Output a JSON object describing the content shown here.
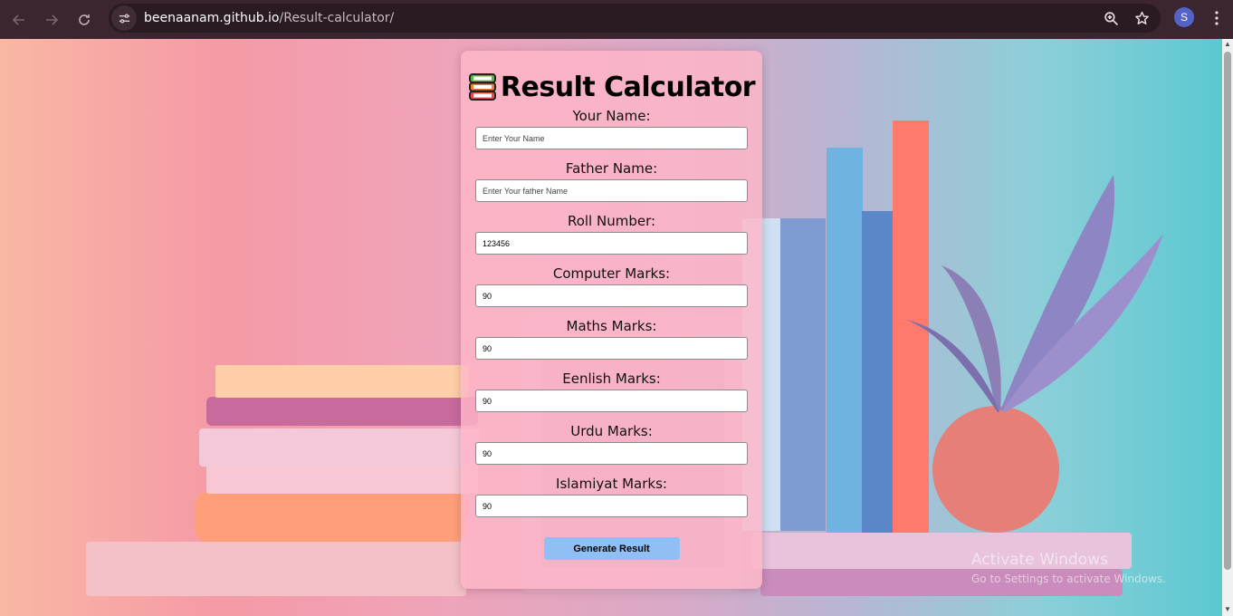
{
  "browser": {
    "url_host": "beenaanam.github.io",
    "url_path": "/Result-calculator/",
    "profile_initial": "S",
    "icons": [
      "back-icon",
      "forward-icon",
      "reload-icon",
      "site-info-icon",
      "zoom-icon",
      "bookmark-star-icon",
      "menu-dots-icon"
    ]
  },
  "app": {
    "title": "Result Calculator",
    "title_icon": "books-icon",
    "fields": [
      {
        "label": "Your Name:",
        "value": "",
        "placeholder": "Enter Your Name"
      },
      {
        "label": "Father Name:",
        "value": "",
        "placeholder": "Enter Your father Name"
      },
      {
        "label": "Roll Number:",
        "value": "123456",
        "placeholder": ""
      },
      {
        "label": "Computer Marks:",
        "value": "90",
        "placeholder": ""
      },
      {
        "label": "Maths Marks:",
        "value": "90",
        "placeholder": ""
      },
      {
        "label": "Eenlish Marks:",
        "value": "90",
        "placeholder": ""
      },
      {
        "label": "Urdu Marks:",
        "value": "90",
        "placeholder": ""
      },
      {
        "label": "Islamiyat Marks:",
        "value": "90",
        "placeholder": ""
      }
    ],
    "button_label": "Generate Result"
  },
  "watermark": {
    "line1": "Activate Windows",
    "line2": "Go to Settings to activate Windows."
  },
  "colors": {
    "card_bg": "#ffb6c8",
    "button_bg": "#8fbff5",
    "chrome_bg": "#3a2531"
  }
}
